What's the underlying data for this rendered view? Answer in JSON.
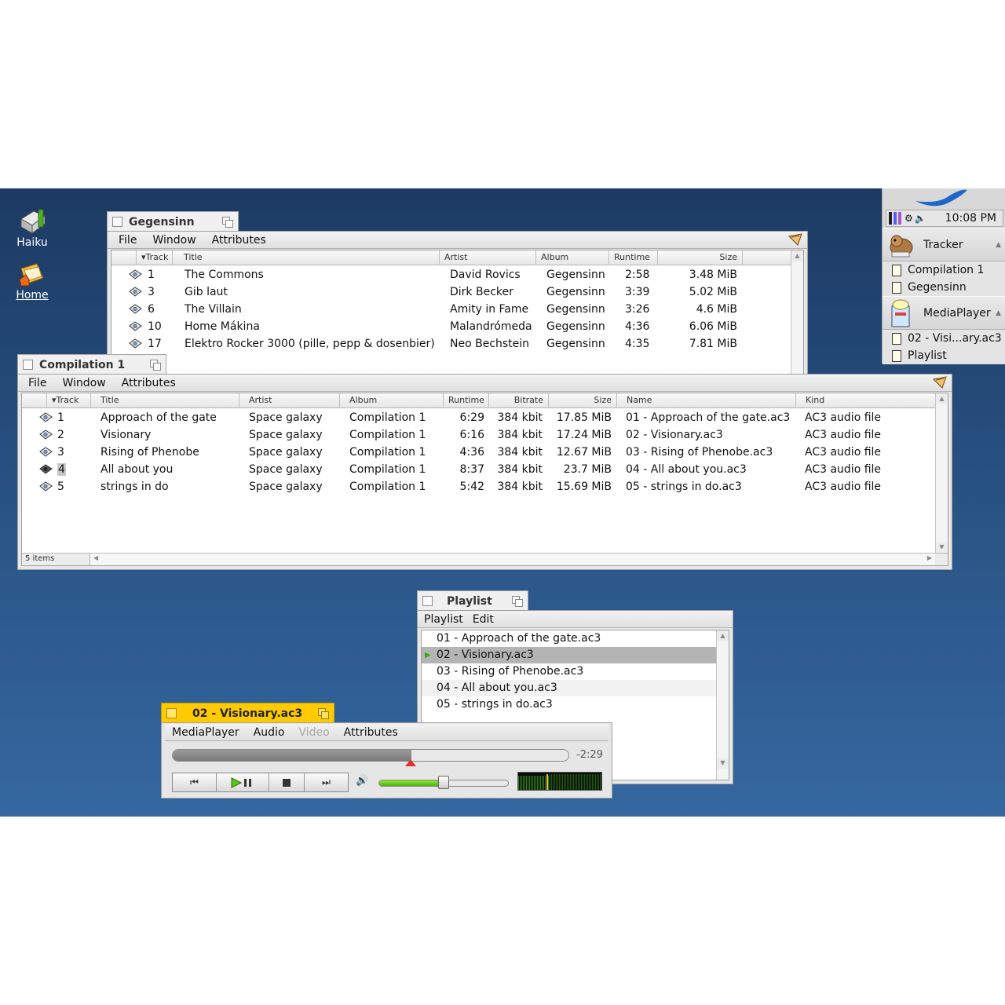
{
  "desktop_icons": [
    {
      "label": "Haiku",
      "icon": "disk-icon"
    },
    {
      "label": "Home",
      "icon": "home-folder-icon"
    }
  ],
  "deskbar": {
    "clock": "10:08 PM",
    "apps": [
      {
        "name": "Tracker",
        "icon": "tracker-icon",
        "windows": [
          "Compilation 1",
          "Gegensinn"
        ]
      },
      {
        "name": "MediaPlayer",
        "icon": "mediaplayer-icon",
        "windows": [
          "02 - Visi...ary.ac3",
          "Playlist"
        ]
      }
    ]
  },
  "gegensinn": {
    "title": "Gegensinn",
    "menu": [
      "File",
      "Window",
      "Attributes"
    ],
    "columns": [
      "Track",
      "Title",
      "Artist",
      "Album",
      "Runtime",
      "Size"
    ],
    "rows": [
      {
        "track": "1",
        "title": "The Commons",
        "artist": "David Rovics",
        "album": "Gegensinn",
        "runtime": "2:58",
        "size": "3.48 MiB"
      },
      {
        "track": "3",
        "title": "Gib laut",
        "artist": "Dirk Becker",
        "album": "Gegensinn",
        "runtime": "3:39",
        "size": "5.02 MiB"
      },
      {
        "track": "6",
        "title": "The Villain",
        "artist": "Amity in Fame",
        "album": "Gegensinn",
        "runtime": "3:26",
        "size": "4.6 MiB"
      },
      {
        "track": "10",
        "title": "Home Mákina",
        "artist": "Malandrómeda",
        "album": "Gegensinn",
        "runtime": "4:36",
        "size": "6.06 MiB"
      },
      {
        "track": "17",
        "title": "Elektro Rocker 3000 (pille, pepp & dosenbier)",
        "artist": "Neo Bechstein",
        "album": "Gegensinn",
        "runtime": "4:35",
        "size": "7.81 MiB"
      }
    ]
  },
  "compilation": {
    "title": "Compilation 1",
    "menu": [
      "File",
      "Window",
      "Attributes"
    ],
    "columns": [
      "Track",
      "Title",
      "Artist",
      "Album",
      "Runtime",
      "Bitrate",
      "Size",
      "Name",
      "Kind"
    ],
    "rows": [
      {
        "track": "1",
        "title": "Approach of the gate",
        "artist": "Space galaxy",
        "album": "Compilation 1",
        "runtime": "6:29",
        "bitrate": "384 kbit",
        "size": "17.85 MiB",
        "name": "01 - Approach of the gate.ac3",
        "kind": "AC3 audio file"
      },
      {
        "track": "2",
        "title": "Visionary",
        "artist": "Space galaxy",
        "album": "Compilation 1",
        "runtime": "6:16",
        "bitrate": "384 kbit",
        "size": "17.24 MiB",
        "name": "02 - Visionary.ac3",
        "kind": "AC3 audio file"
      },
      {
        "track": "3",
        "title": "Rising of Phenobe",
        "artist": "Space galaxy",
        "album": "Compilation 1",
        "runtime": "4:36",
        "bitrate": "384 kbit",
        "size": "12.67 MiB",
        "name": "03 - Rising of Phenobe.ac3",
        "kind": "AC3 audio file"
      },
      {
        "track": "4",
        "title": "All about you",
        "artist": "Space galaxy",
        "album": "Compilation 1",
        "runtime": "8:37",
        "bitrate": "384 kbit",
        "size": "23.7 MiB",
        "name": "04 - All about you.ac3",
        "kind": "AC3 audio file"
      },
      {
        "track": "5",
        "title": "strings in do",
        "artist": "Space galaxy",
        "album": "Compilation 1",
        "runtime": "5:42",
        "bitrate": "384 kbit",
        "size": "15.69 MiB",
        "name": "05 - strings in do.ac3",
        "kind": "AC3 audio file"
      }
    ],
    "status": "5 items"
  },
  "playlist": {
    "title": "Playlist",
    "menu": [
      "Playlist",
      "Edit"
    ],
    "items": [
      "01 - Approach of the gate.ac3",
      "02 - Visionary.ac3",
      "03 - Rising of Phenobe.ac3",
      "04 - All about you.ac3",
      "05 - strings in do.ac3"
    ],
    "playing_index": 1
  },
  "player": {
    "title": "02 - Visionary.ac3",
    "menu": [
      "MediaPlayer",
      "Audio",
      "Video",
      "Attributes"
    ],
    "disabled_menu": [
      "Video"
    ],
    "time_remaining": "-2:29",
    "position_fraction": 0.6,
    "volume_fraction": 0.5,
    "accent_color": "#ffcb00",
    "volume_color": "#6fd21c"
  }
}
